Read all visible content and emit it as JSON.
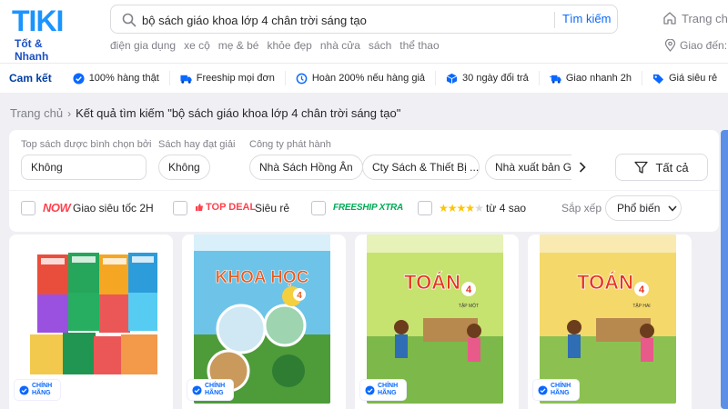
{
  "header": {
    "logo_text": "TIKI",
    "logo_tagline": "Tốt & Nhanh",
    "search_value": "bộ sách giáo khoa lớp 4 chân trời sáng tạo",
    "search_button": "Tìm kiếm",
    "home_label": "Trang chủ",
    "deliver_label": "Giao đến:",
    "quick_links": [
      "điện gia dụng",
      "xe cộ",
      "mẹ & bé",
      "khỏe đẹp",
      "nhà cửa",
      "sách",
      "thể thao"
    ]
  },
  "commitments": {
    "title": "Cam kết",
    "items": [
      "100% hàng thật",
      "Freeship mọi đơn",
      "Hoàn 200% nếu hàng giả",
      "30 ngày đổi trả",
      "Giao nhanh 2h",
      "Giá siêu rẻ"
    ]
  },
  "breadcrumb": {
    "home": "Trang chủ",
    "current": "Kết quả tìm kiếm \"bộ sách giáo khoa lớp 4 chân trời sáng tạo\""
  },
  "filters": {
    "top_label": "Top sách được bình chọn bởi",
    "top_value": "Không",
    "award_label": "Sách hay đạt giải",
    "award_value": "Không",
    "publisher_label": "Công ty phát hành",
    "publishers": [
      "Nhà Sách Hồng Ân",
      "Cty Sách & Thiết Bị ...",
      "Nhà xuất bản Gi"
    ],
    "all_button": "Tất cả",
    "options": {
      "now_badge": "NOW",
      "now_text": "Giao siêu tốc 2H",
      "topdeal_badge": "TOP DEAL",
      "topdeal_text": "Siêu rẻ",
      "freeship_badge": "FREESHIP XTRA",
      "rating_text": "từ 4 sao",
      "rating_stars": 4
    },
    "sort_label": "Sắp xếp",
    "sort_value": "Phổ biến"
  },
  "products": [
    {
      "cover": "book-set",
      "badge": "CHÍNH HÃNG"
    },
    {
      "cover_title": "KHOA HỌC",
      "grade": "4",
      "badge": "CHÍNH HÃNG"
    },
    {
      "cover_title": "TOÁN",
      "grade": "4",
      "volume": "TẬP MỘT",
      "badge": "CHÍNH HÃNG"
    },
    {
      "cover_title": "TOÁN",
      "grade": "4",
      "volume": "TẬP HAI",
      "badge": "CHÍNH HÃNG"
    }
  ],
  "colors": {
    "brand": "#1a4fc4",
    "link": "#0a68ff",
    "accent_red": "#ff424e",
    "green": "#00ab56"
  }
}
